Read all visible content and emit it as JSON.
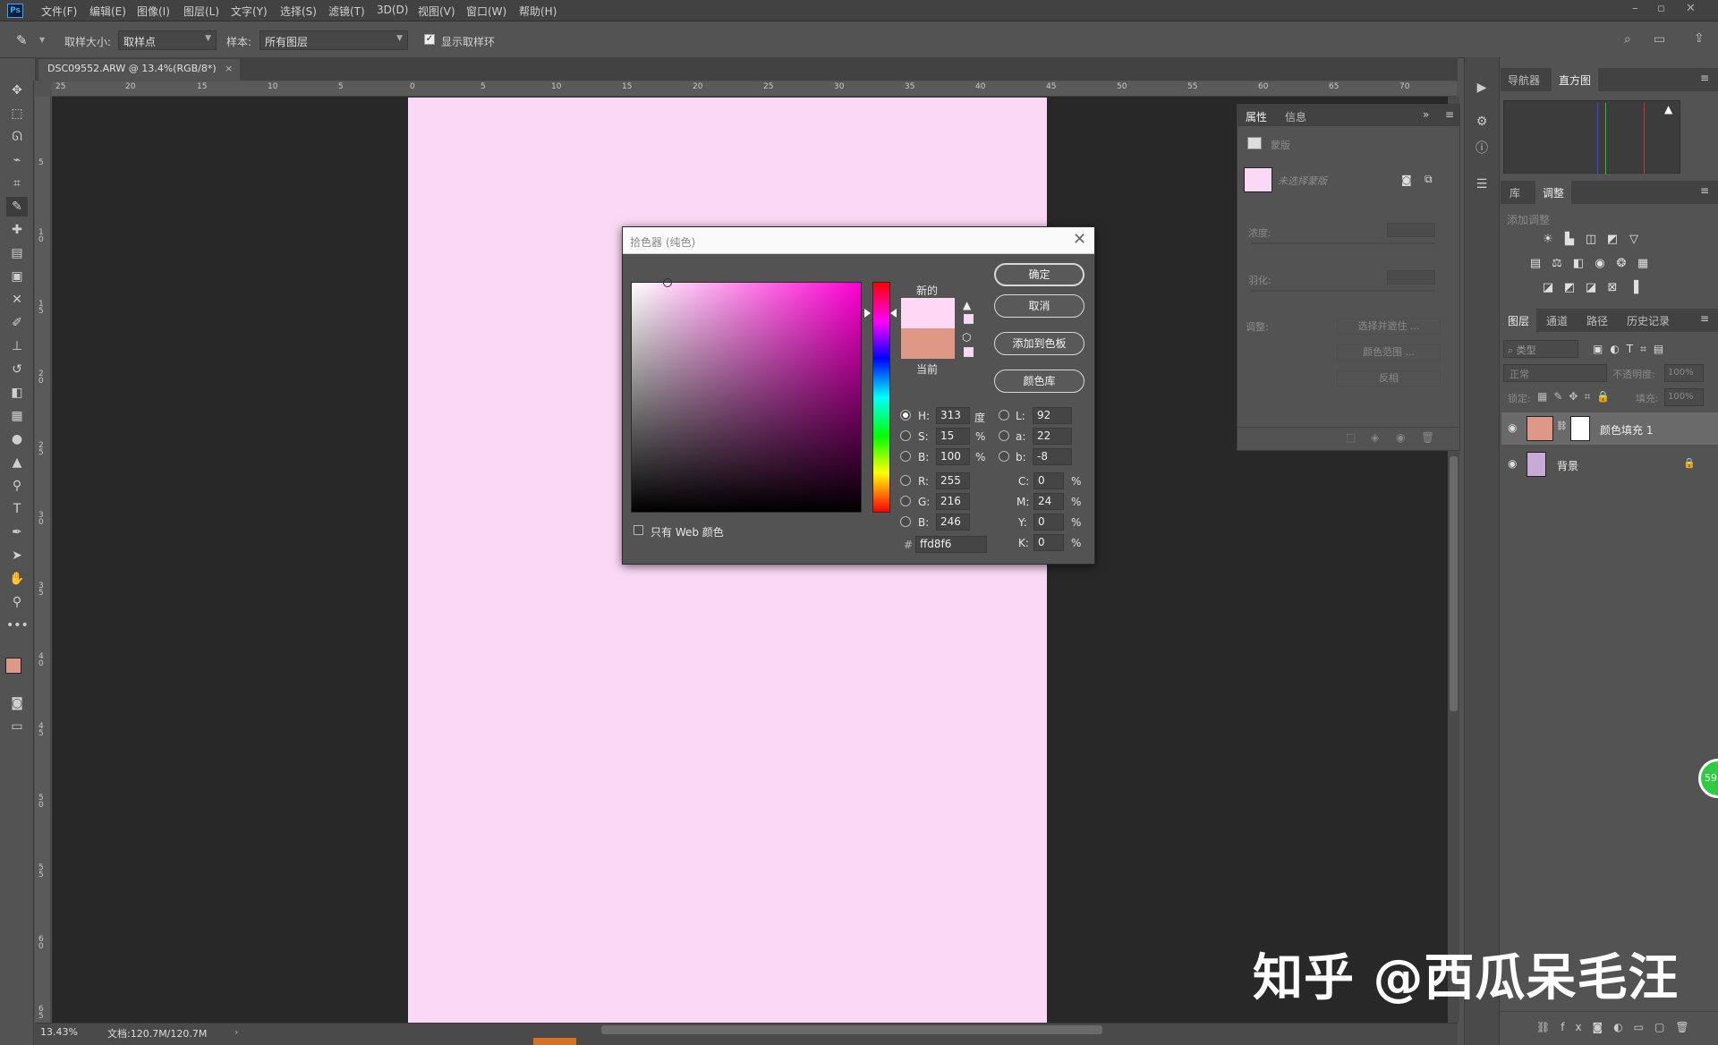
{
  "menubar": {
    "logo": "Ps",
    "items": [
      "文件(F)",
      "编辑(E)",
      "图像(I)",
      "图层(L)",
      "文字(Y)",
      "选择(S)",
      "滤镜(T)",
      "3D(D)",
      "视图(V)",
      "窗口(W)",
      "帮助(H)"
    ],
    "window_controls": [
      "–",
      "▫",
      "✕"
    ]
  },
  "options_bar": {
    "sample_size_label": "取样大小:",
    "sample_size_value": "取样点",
    "sample_label": "样本:",
    "sample_value": "所有图层",
    "show_ring_label": "显示取样环",
    "show_ring_checked": true
  },
  "document": {
    "tab_title": "DSC09552.ARW @ 13.4%(RGB/8*)",
    "tab_close": "×",
    "fill_color": "#fbd8f6",
    "ruler_h": [
      "25",
      "20",
      "15",
      "10",
      "5",
      "0",
      "5",
      "10",
      "15",
      "20",
      "25",
      "30",
      "35",
      "40",
      "45",
      "50",
      "55",
      "60",
      "65",
      "70"
    ],
    "ruler_v": [
      "5",
      "10",
      "15",
      "20",
      "25",
      "30",
      "35",
      "40",
      "45",
      "50",
      "55",
      "60",
      "65"
    ]
  },
  "status": {
    "zoom": "13.43%",
    "doc_size": "文档:120.7M/120.7M"
  },
  "properties_panel": {
    "tabs": [
      "属性",
      "信息"
    ],
    "section_label": "蒙版",
    "mask_label": "未选择蒙版",
    "density_label": "浓度:",
    "feather_label": "羽化:",
    "adjust_label": "调整:",
    "buttons": [
      "选择并遮住 ...",
      "颜色范围 ...",
      "反相"
    ]
  },
  "right_panels": {
    "top_tabs": [
      "导航器",
      "直方图"
    ],
    "mid_tabs": [
      "库",
      "调整"
    ],
    "add_adjustment": "添加调整",
    "layers_tabs": [
      "图层",
      "通道",
      "路径",
      "历史记录"
    ],
    "kind_filter": "类型",
    "blend_mode": "正常",
    "opacity_label": "不透明度:",
    "opacity_value": "100%",
    "lock_label": "锁定:",
    "fill_label": "填充:",
    "fill_value": "100%",
    "layers": [
      {
        "name": "颜色填充 1",
        "thumb_color": "#df9786"
      },
      {
        "name": "背景",
        "thumb_color": "#c9a9d8"
      }
    ]
  },
  "color_picker": {
    "title": "拾色器 (纯色)",
    "new_label": "新的",
    "current_label": "当前",
    "new_color": "#ffd8f6",
    "current_color": "#df9786",
    "buttons": {
      "ok": "确定",
      "cancel": "取消",
      "add_swatch": "添加到色板",
      "color_libraries": "颜色库"
    },
    "web_only_label": "只有 Web 颜色",
    "hsb": {
      "h_label": "H:",
      "h": "313",
      "h_unit": "度",
      "s_label": "S:",
      "s": "15",
      "s_unit": "%",
      "b_label": "B:",
      "b": "100",
      "b_unit": "%"
    },
    "lab": {
      "l_label": "L:",
      "l": "92",
      "a_label": "a:",
      "a": "22",
      "b_label": "b:",
      "b": "-8"
    },
    "rgb": {
      "r_label": "R:",
      "r": "255",
      "g_label": "G:",
      "g": "216",
      "b_label": "B:",
      "b": "246"
    },
    "cmyk": {
      "c_label": "C:",
      "c": "0",
      "m_label": "M:",
      "m": "24",
      "y_label": "Y:",
      "y": "0",
      "k_label": "K:",
      "k": "0",
      "unit": "%"
    },
    "hex_label": "#",
    "hex": "ffd8f6",
    "field_hue_color": "#ff00d4"
  },
  "watermark": "知乎 @西瓜呆毛汪",
  "badge": "59"
}
